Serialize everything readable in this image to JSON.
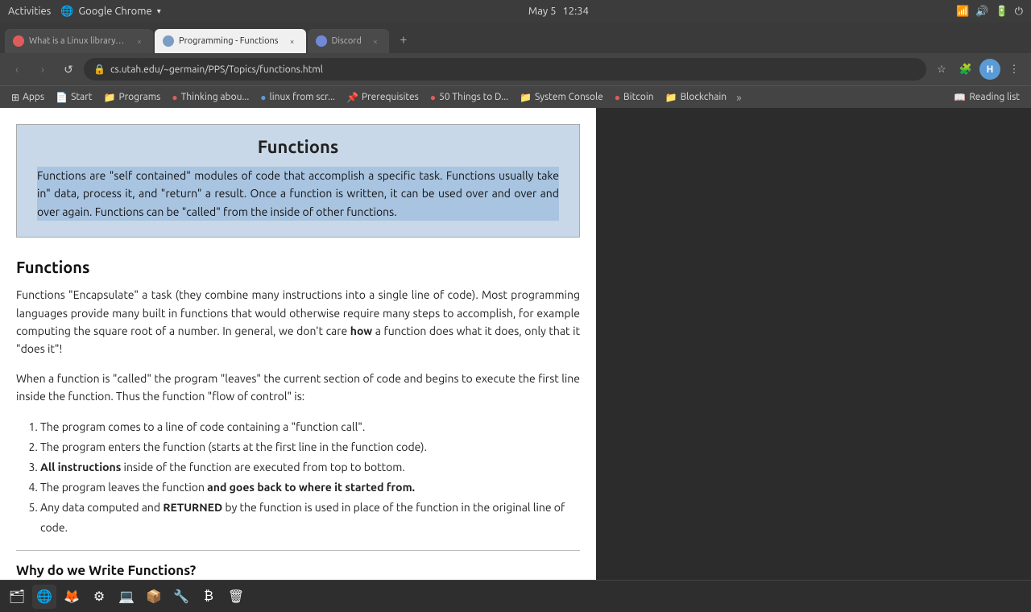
{
  "os": {
    "activities": "Activities",
    "app_name": "Google Chrome",
    "date": "May 5",
    "time": "12:34",
    "indicators": [
      "🔊",
      "📶",
      "🔋"
    ]
  },
  "tabs": [
    {
      "id": "tab1",
      "label": "What is a Linux library? : l...",
      "active": false,
      "close": "×",
      "color": "#e05c5c"
    },
    {
      "id": "tab2",
      "label": "Programming - Functions",
      "active": true,
      "close": "×",
      "color": "#7b9cc4"
    },
    {
      "id": "tab3",
      "label": "Discord",
      "active": false,
      "close": "×",
      "color": "#7289da"
    }
  ],
  "new_tab_label": "+",
  "nav": {
    "back": "‹",
    "forward": "›",
    "reload": "↺",
    "url": "cs.utah.edu/~germain/PPS/Topics/functions.html",
    "star": "☆",
    "extensions": "🧩",
    "profile_initial": "H",
    "menu": "⋮"
  },
  "bookmarks": [
    {
      "label": "Apps",
      "icon": "⊞"
    },
    {
      "label": "Start",
      "icon": "📄"
    },
    {
      "label": "Programs",
      "icon": "📁"
    },
    {
      "label": "Thinking abou...",
      "icon": "🔴"
    },
    {
      "label": "linux from scr...",
      "icon": "🔵"
    },
    {
      "label": "Prerequisites",
      "icon": "📌"
    },
    {
      "label": "50 Things to D...",
      "icon": "🔴"
    },
    {
      "label": "System Console",
      "icon": "📁"
    },
    {
      "label": "Bitcoin",
      "icon": "🔴"
    },
    {
      "label": "Blockchain",
      "icon": "📁"
    }
  ],
  "bookmark_more": "»",
  "reading_list_label": "Reading list",
  "page": {
    "title": "Functions",
    "summary_highlighted": "Functions are \"self contained\" modules of code that accomplish a specific task. Functions usually take in\" data, process it, and \"return\" a result. Once a function is written, it can be used over and over and over again. Functions can be \"called\" from the inside of other functions.",
    "section_title": "Functions",
    "para1": "Functions \"Encapsulate\" a task (they combine many instructions into a single line of code). Most programming languages provide many built in functions that would otherwise require many steps to accomplish, for example computing the square root of a number. In general, we don't care how a function does what it does, only that it \"does it\"!",
    "para2": "When a function is \"called\" the program \"leaves\" the current section of code and begins to execute the first line inside the function. Thus the function \"flow of control\" is:",
    "list_items": [
      "The program comes to a line of code containing a \"function call\".",
      "The program enters the function (starts at the first line in the function code).",
      "All instructions inside of the function are executed from top to bottom.",
      "The program leaves the function and goes back to where it started from.",
      "Any data computed and RETURNED by the function is used in place of the function in the original line of code."
    ],
    "section2_title": "Why do we Write Functions?",
    "bold_item3": "All instructions",
    "bold_item4": "and goes back to where it started from.",
    "bold_item5_pre": "RETURNED",
    "bold_how": "how"
  },
  "taskbar": {
    "icons": [
      {
        "name": "files",
        "symbol": "🗂"
      },
      {
        "name": "chrome",
        "symbol": "🌐"
      },
      {
        "name": "firefox",
        "symbol": "🦊"
      },
      {
        "name": "settings",
        "symbol": "⚙"
      },
      {
        "name": "terminal",
        "symbol": "💻"
      },
      {
        "name": "apps",
        "symbol": "📦"
      },
      {
        "name": "unknown1",
        "symbol": "🔧"
      },
      {
        "name": "bitcoin",
        "symbol": "₿"
      },
      {
        "name": "trash",
        "symbol": "🗑"
      }
    ]
  }
}
